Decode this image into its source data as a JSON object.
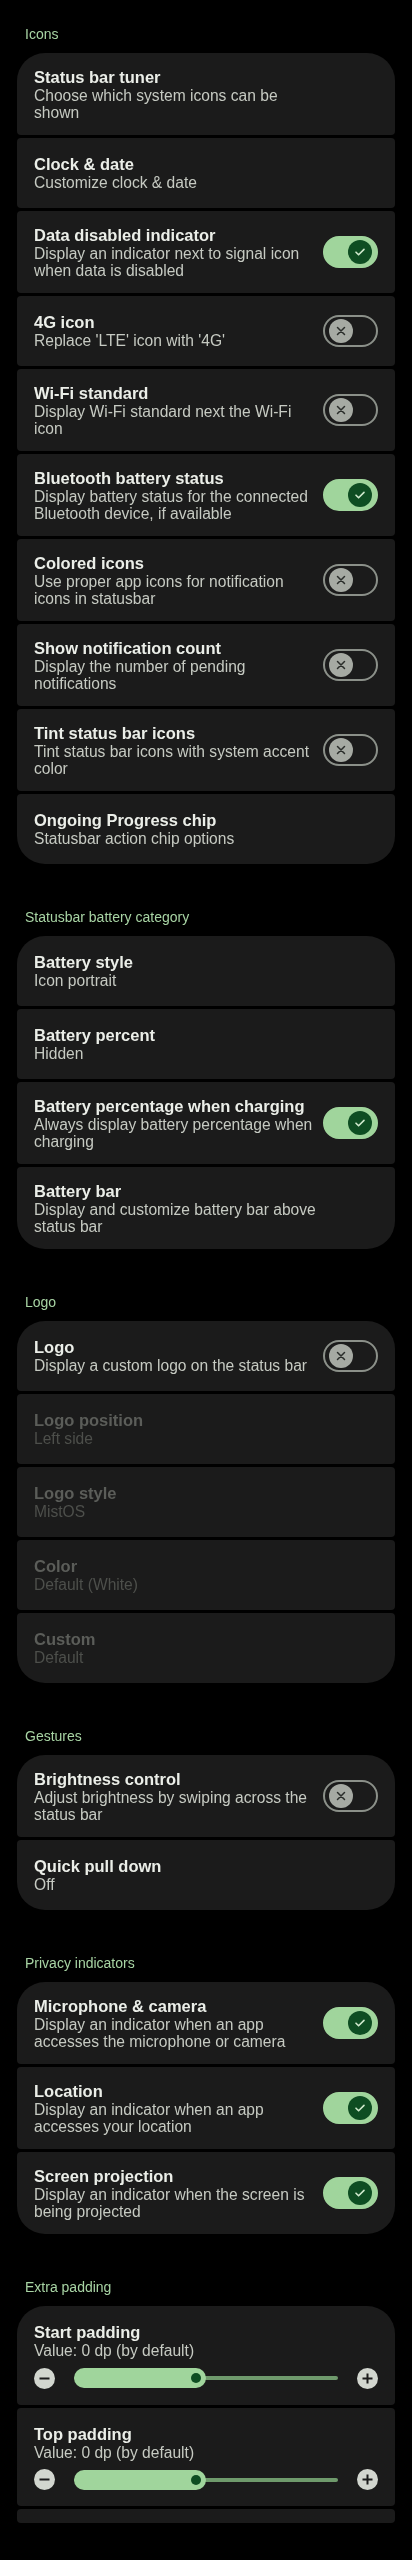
{
  "sections": [
    {
      "title": "Icons",
      "items": [
        {
          "kind": "link",
          "title": "Status bar tuner",
          "summary": "Choose which system icons can be shown"
        },
        {
          "kind": "link",
          "title": "Clock & date",
          "summary": "Customize clock & date"
        },
        {
          "kind": "switch",
          "title": "Data disabled indicator",
          "summary": "Display an indicator next to signal icon when data is disabled",
          "on": true
        },
        {
          "kind": "switch",
          "title": "4G icon",
          "summary": "Replace 'LTE' icon with '4G'",
          "on": false
        },
        {
          "kind": "switch",
          "title": "Wi-Fi standard",
          "summary": "Display Wi-Fi standard next the Wi-Fi icon",
          "on": false
        },
        {
          "kind": "switch",
          "title": "Bluetooth battery status",
          "summary": "Display battery status for the connected Bluetooth device, if available",
          "on": true
        },
        {
          "kind": "switch",
          "title": "Colored icons",
          "summary": "Use proper app icons for notification icons in statusbar",
          "on": false
        },
        {
          "kind": "switch",
          "title": "Show notification count",
          "summary": "Display the number of pending notifications",
          "on": false
        },
        {
          "kind": "switch",
          "title": "Tint status bar icons",
          "summary": "Tint status bar icons with system accent color",
          "on": false
        },
        {
          "kind": "link",
          "title": "Ongoing Progress chip",
          "summary": "Statusbar action chip options"
        }
      ]
    },
    {
      "title": "Statusbar battery category",
      "items": [
        {
          "kind": "link",
          "title": "Battery style",
          "summary": "Icon portrait"
        },
        {
          "kind": "link",
          "title": "Battery percent",
          "summary": "Hidden"
        },
        {
          "kind": "switch",
          "title": "Battery percentage when charging",
          "summary": "Always display battery percentage when charging",
          "on": true
        },
        {
          "kind": "link",
          "title": "Battery bar",
          "summary": "Display and customize battery bar above status bar"
        }
      ]
    },
    {
      "title": "Logo",
      "items": [
        {
          "kind": "switch",
          "title": "Logo",
          "summary": "Display a custom logo on the status bar",
          "on": false,
          "disabled": false
        },
        {
          "kind": "link",
          "title": "Logo position",
          "summary": "Left side",
          "disabled": true
        },
        {
          "kind": "link",
          "title": "Logo style",
          "summary": "MistOS",
          "disabled": true
        },
        {
          "kind": "link",
          "title": "Color",
          "summary": "Default (White)",
          "disabled": true
        },
        {
          "kind": "link",
          "title": "Custom",
          "summary": "Default",
          "disabled": true
        }
      ]
    },
    {
      "title": "Gestures",
      "items": [
        {
          "kind": "switch",
          "title": "Brightness control",
          "summary": "Adjust brightness by swiping across the status bar",
          "on": false
        },
        {
          "kind": "link",
          "title": "Quick pull down",
          "summary": "Off"
        }
      ]
    },
    {
      "title": "Privacy indicators",
      "items": [
        {
          "kind": "switch",
          "title": "Microphone & camera",
          "summary": "Display an indicator when an app accesses the microphone or camera",
          "on": true
        },
        {
          "kind": "switch",
          "title": "Location",
          "summary": "Display an indicator when an app accesses your location",
          "on": true
        },
        {
          "kind": "switch",
          "title": "Screen projection",
          "summary": "Display an indicator when the screen is being projected",
          "on": true
        }
      ]
    },
    {
      "title": "Extra padding",
      "cut": true,
      "items": [
        {
          "kind": "slider",
          "title": "Start padding",
          "summary": "Value: 0 dp (by default)",
          "level": 0.5
        },
        {
          "kind": "slider",
          "title": "Top padding",
          "summary": "Value: 0 dp (by default)",
          "level": 0.5
        }
      ]
    }
  ]
}
